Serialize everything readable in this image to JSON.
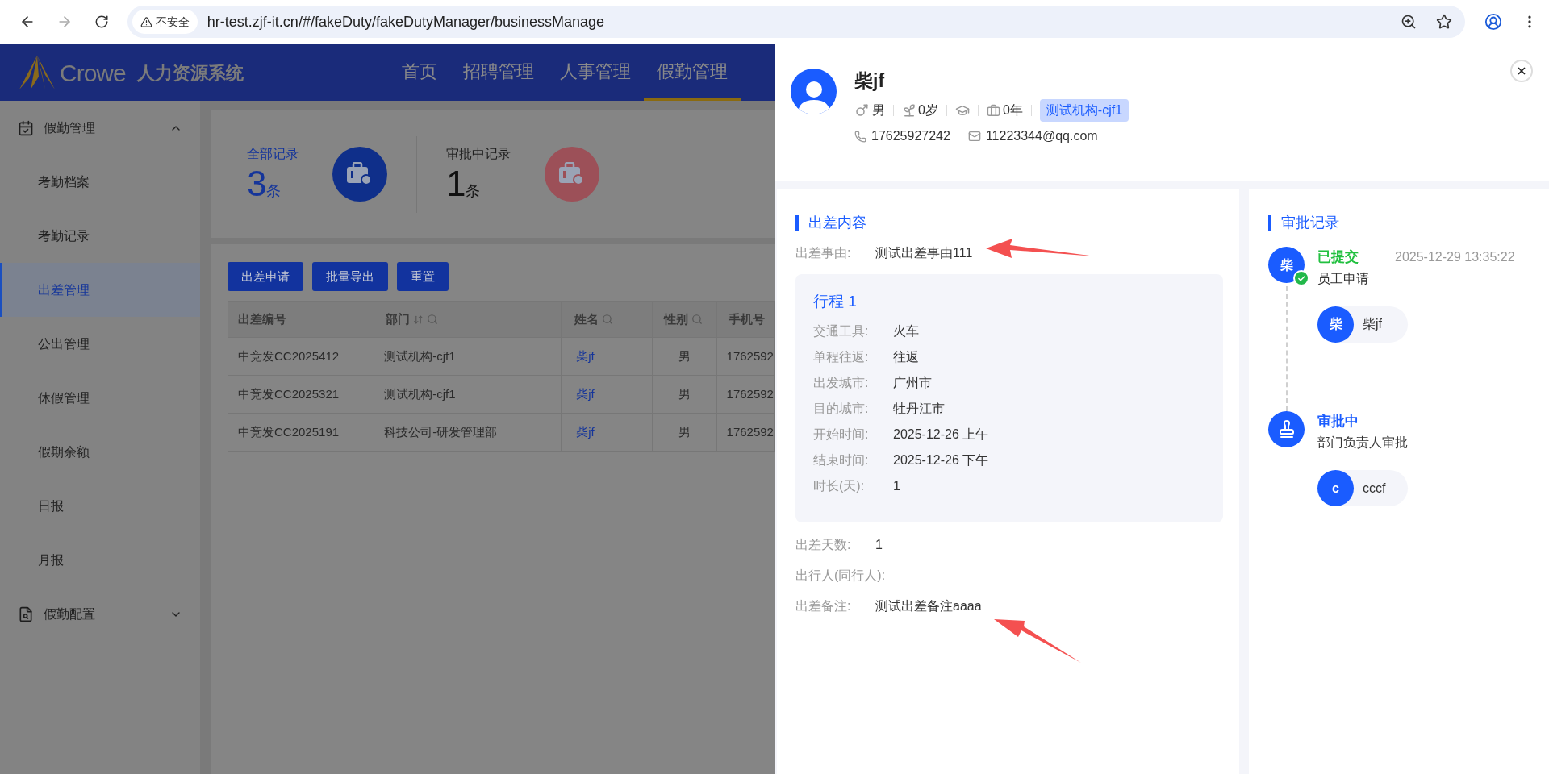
{
  "browser": {
    "security": "不安全",
    "url": "hr-test.zjf-it.cn/#/fakeDuty/fakeDutyManager/businessManage"
  },
  "app": {
    "logo": "Crowe",
    "system_name": "人力资源系统"
  },
  "nav": [
    {
      "label": "首页",
      "selected": false
    },
    {
      "label": "招聘管理",
      "selected": false
    },
    {
      "label": "人事管理",
      "selected": false
    },
    {
      "label": "假勤管理",
      "selected": true
    }
  ],
  "sidebar": [
    {
      "label": "假勤管理",
      "kind": "calendar",
      "expanded": true,
      "children": [
        {
          "label": "考勤档案",
          "selected": false
        },
        {
          "label": "考勤记录",
          "selected": false
        },
        {
          "label": "出差管理",
          "selected": true
        },
        {
          "label": "公出管理",
          "selected": false
        },
        {
          "label": "休假管理",
          "selected": false
        },
        {
          "label": "假期余额",
          "selected": false
        },
        {
          "label": "日报",
          "selected": false
        },
        {
          "label": "月报",
          "selected": false
        }
      ]
    },
    {
      "label": "假勤配置",
      "kind": "config",
      "expanded": false
    }
  ],
  "stats": [
    {
      "kind": "all",
      "label": "全部记录",
      "count": "3",
      "unit": "条"
    },
    {
      "kind": "pending",
      "label": "审批中记录",
      "count": "1",
      "unit": "条"
    }
  ],
  "toolbar": [
    "出差申请",
    "批量导出",
    "重置"
  ],
  "table": {
    "columns": [
      {
        "label": "出差编号",
        "sortable": false,
        "searchable": false
      },
      {
        "label": "部门",
        "sortable": true,
        "searchable": true
      },
      {
        "label": "姓名",
        "sortable": false,
        "searchable": true
      },
      {
        "label": "性别",
        "sortable": false,
        "searchable": true
      },
      {
        "label": "手机号",
        "sortable": false,
        "searchable": false
      }
    ],
    "rows": [
      [
        "中竞发CC2025412",
        "测试机构-cjf1",
        "柴jf",
        "男",
        "1762592"
      ],
      [
        "中竞发CC2025321",
        "测试机构-cjf1",
        "柴jf",
        "男",
        "1762592"
      ],
      [
        "中竞发CC2025191",
        "科技公司-研发管理部",
        "柴jf",
        "男",
        "1762592"
      ]
    ]
  },
  "profile": {
    "name": "柴jf",
    "gender": "男",
    "age": "0岁",
    "years": "0年",
    "org": "测试机构-cjf1",
    "phone": "17625927242",
    "email": "11223344@qq.com"
  },
  "trip": {
    "title": "出差内容",
    "fields": [
      {
        "label": "出差事由:",
        "value": "测试出差事由111"
      }
    ],
    "itineraries": [
      {
        "title": "行程 1",
        "fields": [
          {
            "label": "交通工具:",
            "value": "火车"
          },
          {
            "label": "单程往返:",
            "value": "往返"
          },
          {
            "label": "出发城市:",
            "value": "广州市"
          },
          {
            "label": "目的城市:",
            "value": "牡丹江市"
          },
          {
            "label": "开始时间:",
            "value": "2025-12-26 上午"
          },
          {
            "label": "结束时间:",
            "value": "2025-12-26 下午"
          },
          {
            "label": "时长(天):",
            "value": "1"
          }
        ]
      }
    ],
    "more_fields": [
      {
        "label": "出差天数:",
        "value": "1"
      },
      {
        "label": "出行人(同行人):"
      },
      {
        "label": "出差备注:",
        "value": "测试出差备注aaaa"
      }
    ]
  },
  "approval": {
    "title": "审批记录",
    "steps": [
      {
        "kind": "submitted",
        "avatar": "柴",
        "status": "已提交",
        "time": "2025-12-29 13:35:22",
        "description": "员工申请",
        "approver": {
          "initial": "柴",
          "name": "柴jf"
        }
      },
      {
        "kind": "pending",
        "status": "审批中",
        "description": "部门负责人审批",
        "approver": {
          "initial": "c",
          "name": "cccf"
        }
      }
    ]
  }
}
